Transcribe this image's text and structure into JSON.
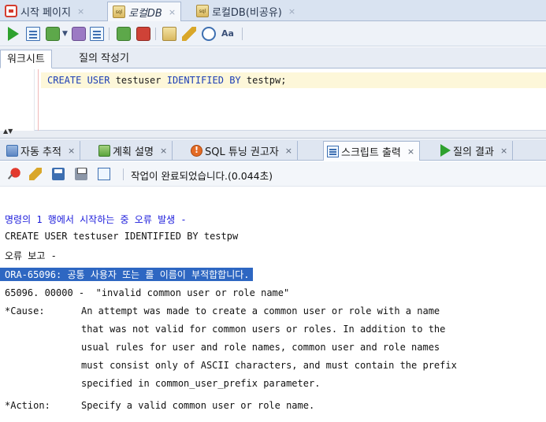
{
  "doc_tabs": [
    {
      "label": "시작 페이지",
      "close": "×"
    },
    {
      "label": "로컬DB",
      "close": "×"
    },
    {
      "label": "로컬DB(비공유)",
      "close": "×"
    }
  ],
  "toolbar": {
    "icons": [
      "run-statement-icon",
      "run-script-icon",
      "commit-icon",
      "dropdown-arrow-icon",
      "rollback-icon",
      "explain-plan-icon",
      "autotrace-icon",
      "sql-tuning-icon",
      "clear-icon",
      "history-icon",
      "format-case-icon"
    ],
    "aa_label": "Aa"
  },
  "worksheet_tabs": [
    {
      "label": "워크시트"
    },
    {
      "label": "질의 작성기"
    }
  ],
  "editor": {
    "sql_keyword_1": "CREATE USER",
    "sql_user": " testuser ",
    "sql_keyword_2": "IDENTIFIED BY",
    "sql_password": " testpw;"
  },
  "bottom_tabs": [
    {
      "label": "자동 추적",
      "close": "×"
    },
    {
      "label": "계획 설명",
      "close": "×"
    },
    {
      "label": "SQL 튜닝 권고자",
      "close": "×"
    },
    {
      "label": "스크립트 출력",
      "close": "×"
    },
    {
      "label": "질의 결과",
      "close": "×"
    }
  ],
  "output_toolbar": {
    "status": "작업이 완료되었습니다.(0.044초)"
  },
  "output": {
    "error_header": "명령의 1 행에서 시작하는 중 오류 발생 -",
    "command": "CREATE USER testuser IDENTIFIED BY testpw",
    "report_label": "오류 보고 -",
    "ora_error": "ORA-65096: 공통 사용자 또는 롤 이름이 부적합합니다.",
    "error_code_line": "65096. 00000 -  \"invalid common user or role name\"",
    "cause_label": "*Cause:",
    "cause_lines": [
      "An attempt was made to create a common user or role with a name",
      "that was not valid for common users or roles. In addition to the",
      "usual rules for user and role names, common user and role names",
      "must consist only of ASCII characters, and must contain the prefix",
      "specified in common_user_prefix parameter."
    ],
    "action_label": "*Action:",
    "action_text": "Specify a valid common user or role name."
  }
}
